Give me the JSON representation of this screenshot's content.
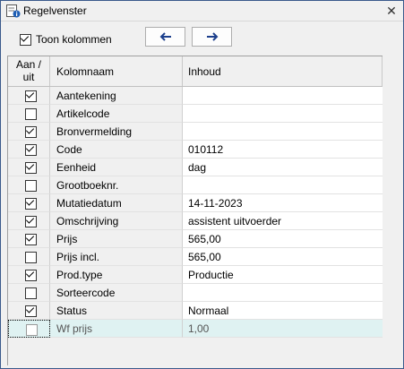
{
  "window": {
    "title": "Regelvenster",
    "close_glyph": "✕",
    "icon": "info-window-icon"
  },
  "toolbar": {
    "toon_kolommen_label": "Toon kolommen",
    "toon_kolommen_checked": true,
    "prev_icon": "arrow-left-icon",
    "next_icon": "arrow-right-icon"
  },
  "grid": {
    "columns": {
      "aan": "Aan /\nuit",
      "naam": "Kolomnaam",
      "inhoud": "Inhoud"
    },
    "rows": [
      {
        "checked": true,
        "naam": "Aantekening",
        "inhoud": ""
      },
      {
        "checked": false,
        "naam": "Artikelcode",
        "inhoud": ""
      },
      {
        "checked": true,
        "naam": "Bronvermelding",
        "inhoud": ""
      },
      {
        "checked": true,
        "naam": "Code",
        "inhoud": "010112"
      },
      {
        "checked": true,
        "naam": "Eenheid",
        "inhoud": "dag"
      },
      {
        "checked": false,
        "naam": "Grootboeknr.",
        "inhoud": ""
      },
      {
        "checked": true,
        "naam": "Mutatiedatum",
        "inhoud": "14-11-2023"
      },
      {
        "checked": true,
        "naam": "Omschrijving",
        "inhoud": "assistent uitvoerder"
      },
      {
        "checked": true,
        "naam": "Prijs",
        "inhoud": "565,00"
      },
      {
        "checked": false,
        "naam": "Prijs incl.",
        "inhoud": "565,00"
      },
      {
        "checked": true,
        "naam": "Prod.type",
        "inhoud": "Productie"
      },
      {
        "checked": false,
        "naam": "Sorteercode",
        "inhoud": ""
      },
      {
        "checked": true,
        "naam": "Status",
        "inhoud": "Normaal"
      },
      {
        "checked": false,
        "naam": "Wf prijs",
        "inhoud": "1,00",
        "selected": true
      }
    ]
  }
}
